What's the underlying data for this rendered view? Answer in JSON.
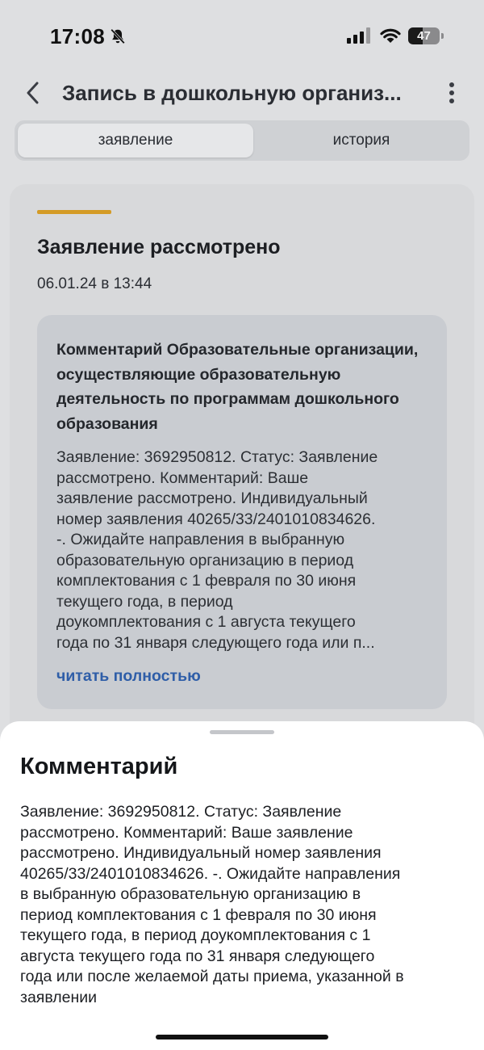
{
  "status_bar": {
    "time": "17:08",
    "battery_level": "47",
    "battery_fraction": 0.47
  },
  "header": {
    "title": "Запись в дошкольную организ...",
    "back_icon": "chevron-left-icon",
    "more_icon": "more-vertical-icon"
  },
  "tabs": [
    {
      "label": "заявление",
      "active": true
    },
    {
      "label": "история",
      "active": false
    }
  ],
  "card": {
    "accent_color": "#d49b26",
    "title": "Заявление рассмотрено",
    "date": "06.01.24 в 13:44",
    "comment": {
      "heading": "Комментарий Образовательные организации, осуществляющие образовательную деятельность по программам дошкольного образования",
      "body": "Заявление: 3692950812. Статус: Заявление\nрассмотрено. Комментарий: Ваше\nзаявление рассмотрено. Индивидуальный\nномер заявления 40265/33/2401010834626.\n-. Ожидайте направления в выбранную\nобразовательную организацию в период\nкомплектования с 1 февраля по 30 июня\nтекущего года, в период\nдоукомплектования с 1 августа текущего\nгода по 31 января следующего года или п...",
      "read_more": "читать полностью"
    }
  },
  "sheet": {
    "title": "Комментарий",
    "body": "Заявление: 3692950812. Статус: Заявление\nрассмотрено. Комментарий: Ваше заявление\nрассмотрено. Индивидуальный номер заявления\n40265/33/2401010834626. -. Ожидайте направления\nв выбранную образовательную организацию в\nпериод комплектования с 1 февраля по 30 июня\nтекущего года, в период доукомплектования с 1\nавгуста текущего года по 31 января следующего\nгода или после желаемой даты приема, указанной в\nзаявлении"
  },
  "colors": {
    "link": "#2f5ea8",
    "background": "#dedfe1"
  }
}
